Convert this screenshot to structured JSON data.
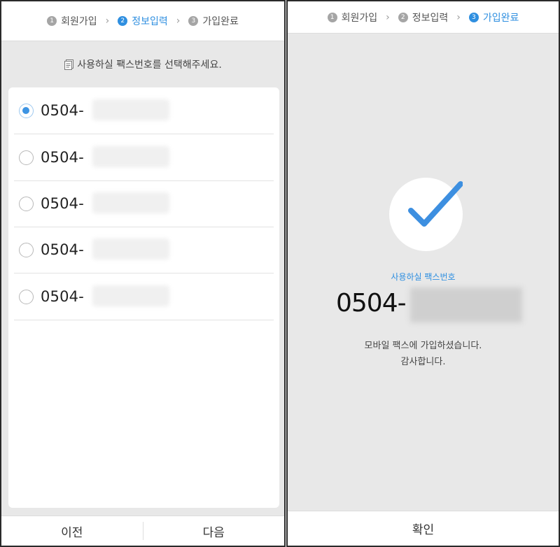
{
  "left_screen": {
    "steps": [
      {
        "num": "1",
        "label": "회원가입"
      },
      {
        "num": "2",
        "label": "정보입력"
      },
      {
        "num": "3",
        "label": "가입완료"
      }
    ],
    "instruction": "사용하실 팩스번호를 선택해주세요.",
    "fax_options": [
      {
        "prefix": "0504-",
        "selected": true
      },
      {
        "prefix": "0504-",
        "selected": false
      },
      {
        "prefix": "0504-",
        "selected": false
      },
      {
        "prefix": "0504-",
        "selected": false
      },
      {
        "prefix": "0504-",
        "selected": false
      }
    ],
    "prev_label": "이전",
    "next_label": "다음"
  },
  "right_screen": {
    "steps": [
      {
        "num": "1",
        "label": "회원가입"
      },
      {
        "num": "2",
        "label": "정보입력"
      },
      {
        "num": "3",
        "label": "가입완료"
      }
    ],
    "fax_label": "사용하실 팩스번호",
    "fax_number_prefix": "0504-",
    "message_line1": "모바일 팩스에 가입하셨습니다.",
    "message_line2": "감사합니다.",
    "confirm_label": "확인"
  },
  "colors": {
    "accent": "#2f8fe0",
    "background": "#e8e8e8",
    "inactive_step": "#a5a5a5"
  }
}
